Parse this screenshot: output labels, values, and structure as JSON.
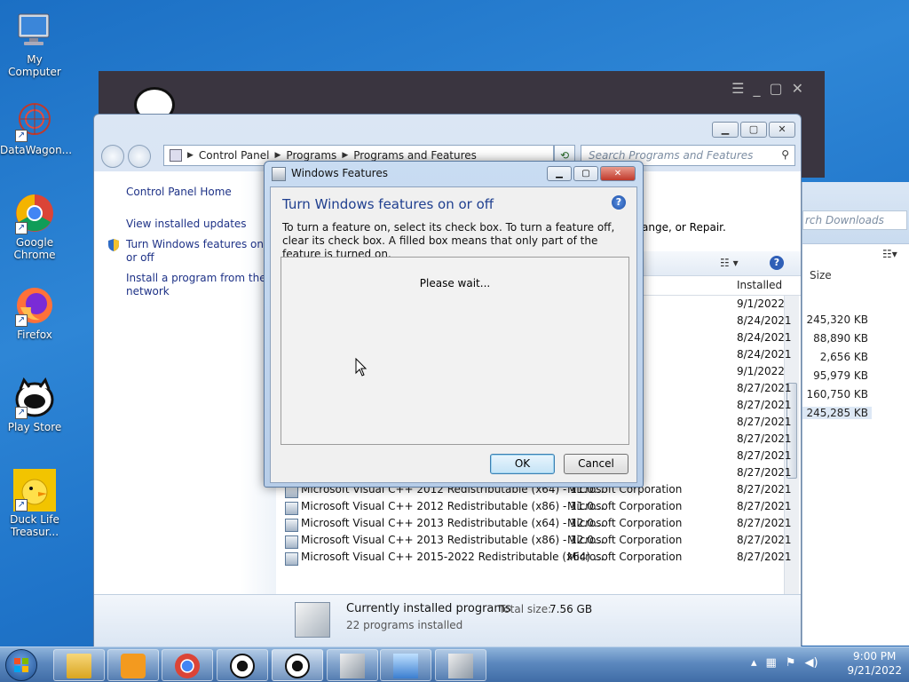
{
  "desktop": {
    "icons": [
      {
        "label": "My Computer"
      },
      {
        "label": "DataWagon..."
      },
      {
        "label": "Google Chrome"
      },
      {
        "label": "Firefox"
      },
      {
        "label": "Play Store"
      },
      {
        "label": "Duck Life Treasur..."
      }
    ]
  },
  "control_panel": {
    "address": [
      "Control Panel",
      "Programs",
      "Programs and Features"
    ],
    "search_placeholder": "Search Programs and Features",
    "left_links": [
      "Control Panel Home",
      "View installed updates",
      "Turn Windows features on or off",
      "Install a program from the network"
    ],
    "partial_text": "ange, or Repair.",
    "column_installed": "Installed",
    "rows": [
      {
        "name": "",
        "publisher": "",
        "date": "9/1/2022"
      },
      {
        "name": "",
        "publisher": "",
        "date": "8/24/2021"
      },
      {
        "name": "",
        "publisher": "",
        "date": "8/24/2021"
      },
      {
        "name": "",
        "publisher": "",
        "date": "8/24/2021"
      },
      {
        "name": "",
        "publisher": "ration",
        "date": "9/1/2022"
      },
      {
        "name": "",
        "publisher": "ration",
        "date": "8/27/2021"
      },
      {
        "name": "",
        "publisher": "ration",
        "date": "8/27/2021"
      },
      {
        "name": "",
        "publisher": "ration",
        "date": "8/27/2021"
      },
      {
        "name": "",
        "publisher": "ration",
        "date": "8/27/2021"
      },
      {
        "name": "",
        "publisher": "ration",
        "date": "8/27/2021"
      },
      {
        "name": "",
        "publisher": "ration",
        "date": "8/27/2021"
      },
      {
        "name": "Microsoft Visual C++ 2012 Redistributable (x64) - 11.0...",
        "publisher": "Microsoft Corporation",
        "date": "8/27/2021"
      },
      {
        "name": "Microsoft Visual C++ 2012 Redistributable (x86) - 11.0...",
        "publisher": "Microsoft Corporation",
        "date": "8/27/2021"
      },
      {
        "name": "Microsoft Visual C++ 2013 Redistributable (x64) - 12.0...",
        "publisher": "Microsoft Corporation",
        "date": "8/27/2021"
      },
      {
        "name": "Microsoft Visual C++ 2013 Redistributable (x86) - 12.0...",
        "publisher": "Microsoft Corporation",
        "date": "8/27/2021"
      },
      {
        "name": "Microsoft Visual C++ 2015-2022 Redistributable (x64) ...",
        "publisher": "Microsoft Corporation",
        "date": "8/27/2021"
      }
    ],
    "details": {
      "title": "Currently installed programs",
      "total_label": "Total size:",
      "total_value": "7.56 GB",
      "count": "22 programs installed"
    }
  },
  "right_window": {
    "search_placeholder": "rch Downloads",
    "size_header": "Size",
    "sizes": [
      "245,320 KB",
      "88,890 KB",
      "2,656 KB",
      "95,979 KB",
      "160,750 KB",
      "245,285 KB"
    ]
  },
  "dialog": {
    "title": "Windows Features",
    "heading": "Turn Windows features on or off",
    "description": "To turn a feature on, select its check box. To turn a feature off, clear its check box. A filled box means that only part of the feature is turned on.",
    "status": "Please wait...",
    "ok": "OK",
    "cancel": "Cancel"
  },
  "taskbar": {
    "time": "9:00 PM",
    "date": "9/21/2022"
  }
}
